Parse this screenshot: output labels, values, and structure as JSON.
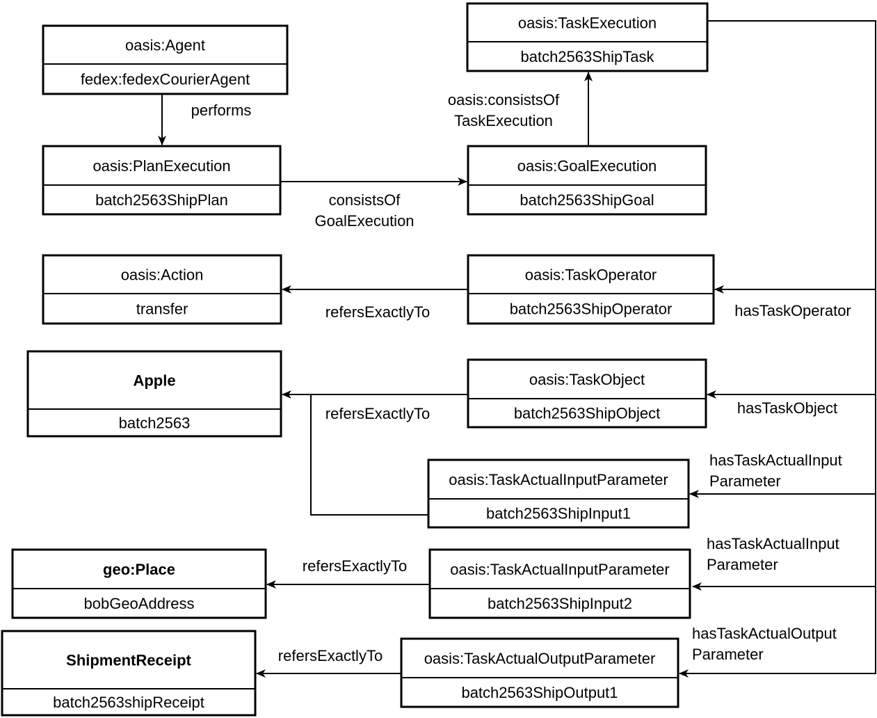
{
  "boxes": [
    {
      "id": "agent",
      "type": "oasis:Agent",
      "instance": "fedex:fedexCourierAgent",
      "bold": false
    },
    {
      "id": "plan",
      "type": "oasis:PlanExecution",
      "instance": "batch2563ShipPlan",
      "bold": false
    },
    {
      "id": "goal",
      "type": "oasis:GoalExecution",
      "instance": "batch2563ShipGoal",
      "bold": false
    },
    {
      "id": "task",
      "type": "oasis:TaskExecution",
      "instance": "batch2563ShipTask",
      "bold": false
    },
    {
      "id": "action",
      "type": "oasis:Action",
      "instance": "transfer",
      "bold": false
    },
    {
      "id": "operator",
      "type": "oasis:TaskOperator",
      "instance": "batch2563ShipOperator",
      "bold": false
    },
    {
      "id": "apple",
      "type": "Apple",
      "instance": "batch2563",
      "bold": true
    },
    {
      "id": "object",
      "type": "oasis:TaskObject",
      "instance": "batch2563ShipObject",
      "bold": false
    },
    {
      "id": "input1",
      "type": "oasis:TaskActualInputParameter",
      "instance": "batch2563ShipInput1",
      "bold": false
    },
    {
      "id": "place",
      "type": "geo:Place",
      "instance": "bobGeoAddress",
      "bold": true
    },
    {
      "id": "input2",
      "type": "oasis:TaskActualInputParameter",
      "instance": "batch2563ShipInput2",
      "bold": false
    },
    {
      "id": "receipt",
      "type": "ShipmentReceipt",
      "instance": "batch2563shipReceipt",
      "bold": true
    },
    {
      "id": "output1",
      "type": "oasis:TaskActualOutputParameter",
      "instance": "batch2563ShipOutput1",
      "bold": false
    }
  ],
  "edges": [
    {
      "id": "performs",
      "from": "agent",
      "to": "plan",
      "label": [
        "performs"
      ]
    },
    {
      "id": "consists-goal",
      "from": "plan",
      "to": "goal",
      "label": [
        "consistsOf",
        "GoalExecution"
      ]
    },
    {
      "id": "consists-task",
      "from": "goal",
      "to": "task",
      "label": [
        "oasis:consistsOf",
        "TaskExecution"
      ]
    },
    {
      "id": "has-operator",
      "from": "task",
      "to": "operator",
      "label": [
        "hasTaskOperator"
      ]
    },
    {
      "id": "has-object",
      "from": "task",
      "to": "object",
      "label": [
        "hasTaskObject"
      ]
    },
    {
      "id": "has-input1",
      "from": "task",
      "to": "input1",
      "label": [
        "hasTaskActualInput",
        "Parameter"
      ]
    },
    {
      "id": "has-input2",
      "from": "task",
      "to": "input2",
      "label": [
        "hasTaskActualInput",
        "Parameter"
      ]
    },
    {
      "id": "has-output1",
      "from": "task",
      "to": "output1",
      "label": [
        "hasTaskActualOutput",
        "Parameter"
      ]
    },
    {
      "id": "operator-refers",
      "from": "operator",
      "to": "action",
      "label": [
        "refersExactlyTo"
      ]
    },
    {
      "id": "object-refers",
      "from": "object",
      "to": "apple",
      "label": [
        "refersExactlyTo"
      ]
    },
    {
      "id": "input1-refers",
      "from": "input1",
      "to": "apple",
      "label": []
    },
    {
      "id": "input2-refers",
      "from": "input2",
      "to": "place",
      "label": [
        "refersExactlyTo"
      ]
    },
    {
      "id": "output1-refers",
      "from": "output1",
      "to": "receipt",
      "label": [
        "refersExactlyTo"
      ]
    }
  ]
}
